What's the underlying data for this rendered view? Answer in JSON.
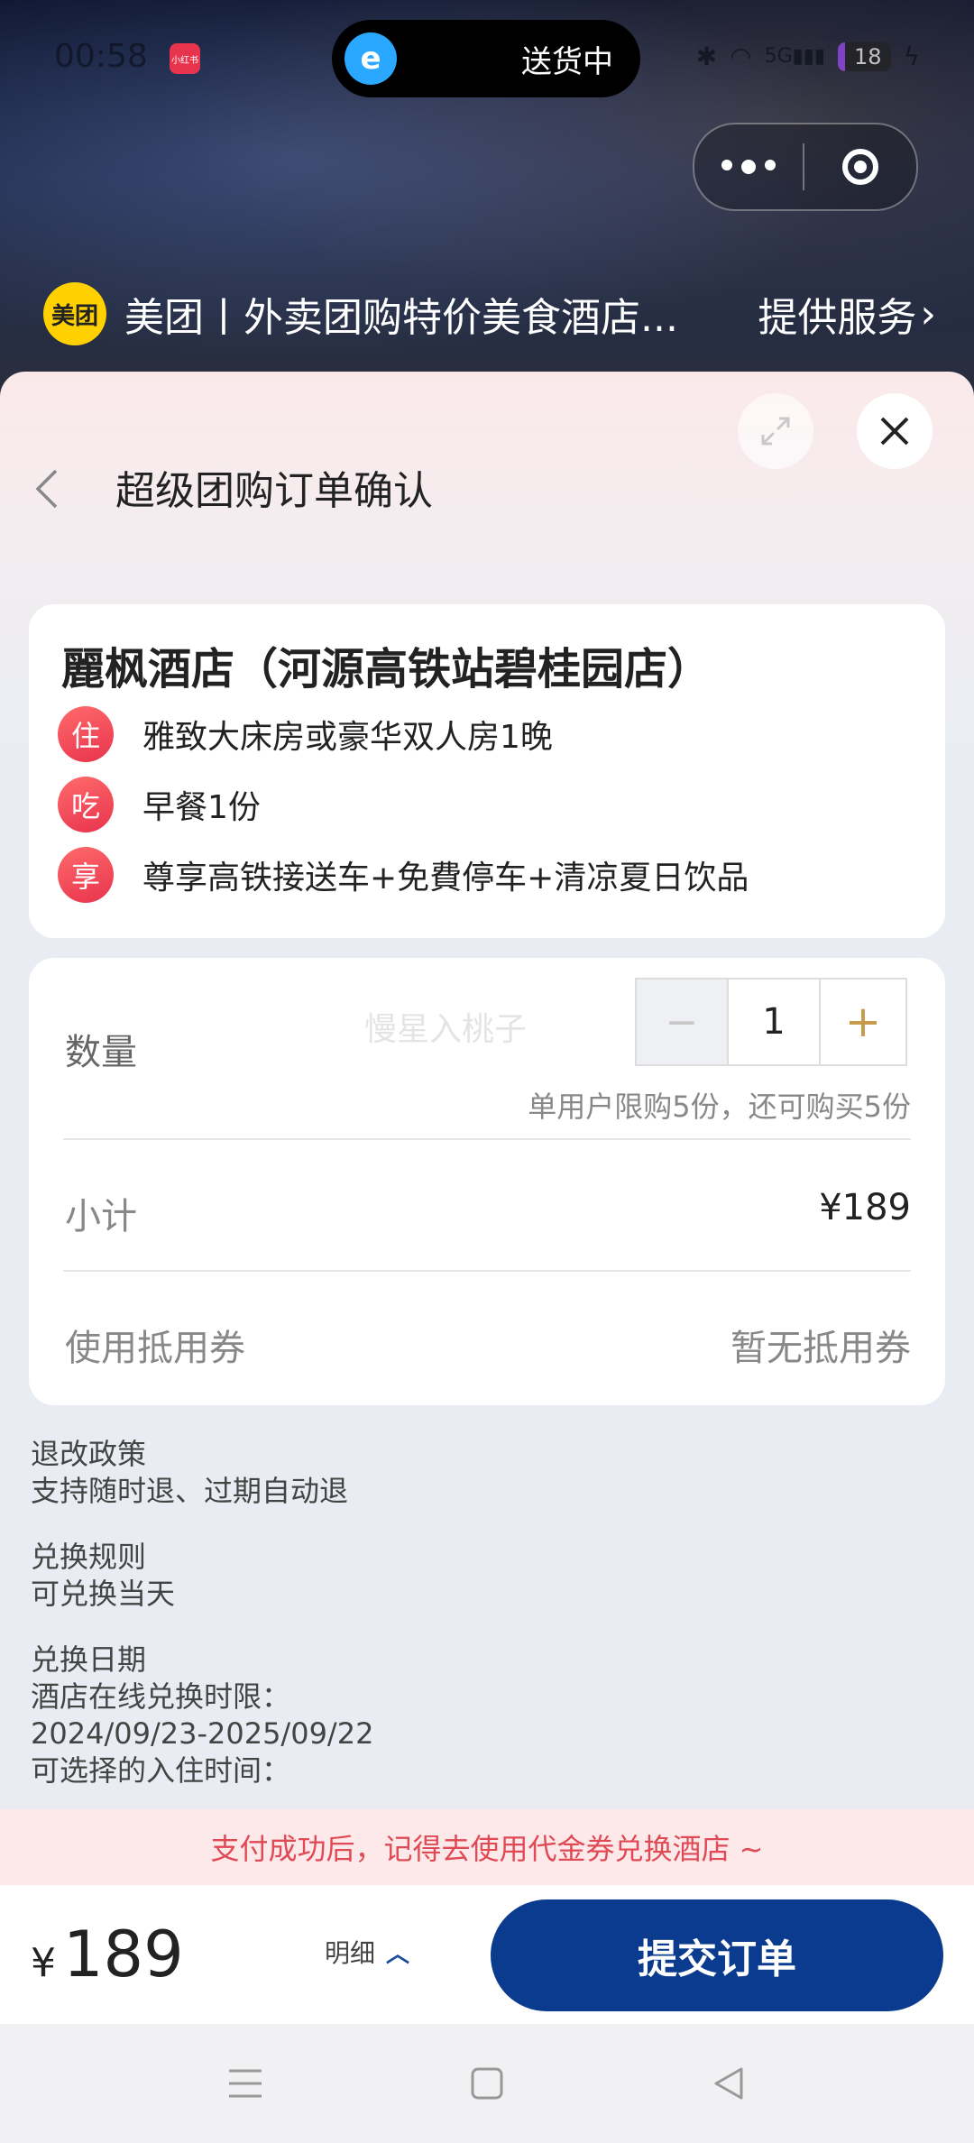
{
  "status_bar": {
    "time": "00:58",
    "app_badge": "小红书",
    "pill_text": "送货中",
    "network": "5G",
    "battery": "18"
  },
  "service": {
    "logo_text": "美团",
    "name": "美团丨外卖团购特价美食酒店...",
    "link": "提供服务"
  },
  "header": {
    "title": "超级团购订单确认"
  },
  "hotel": {
    "name": "麗枫酒店（河源高铁站碧桂园店）",
    "perks": [
      {
        "badge": "住",
        "text": "雅致大床房或豪华双人房1晚"
      },
      {
        "badge": "吃",
        "text": "早餐1份"
      },
      {
        "badge": "享",
        "text": "尊享高铁接送车+免費停车+清凉夏日饮品"
      }
    ]
  },
  "order": {
    "quantity_label": "数量",
    "watermark": "慢星入桃子",
    "quantity_value": "1",
    "minus": "−",
    "plus": "+",
    "limit_note": "单用户限购5份，还可购买5份",
    "subtotal_label": "小计",
    "subtotal_value": "¥189",
    "coupon_label": "使用抵用券",
    "coupon_value": "暂无抵用券"
  },
  "policy": {
    "refund_title": "退改政策",
    "refund_text": "支持随时退、过期自动退",
    "exchange_title": "兑换规则",
    "exchange_text": "可兑换当天",
    "date_title": "兑换日期",
    "date_line1": "酒店在线兑换时限：",
    "date_line2": "2024/09/23-2025/09/22",
    "date_line3": "可选择的入住时间："
  },
  "banner": {
    "text": "支付成功后，记得去使用代金券兑换酒店 ~"
  },
  "checkout": {
    "currency": "¥",
    "amount": "189",
    "detail_label": "明细",
    "submit_label": "提交订单"
  },
  "colors": {
    "primary": "#0b3b8f",
    "accent_red": "#e8334d",
    "banner_text": "#e04a55",
    "meituan_yellow": "#ffd100"
  }
}
